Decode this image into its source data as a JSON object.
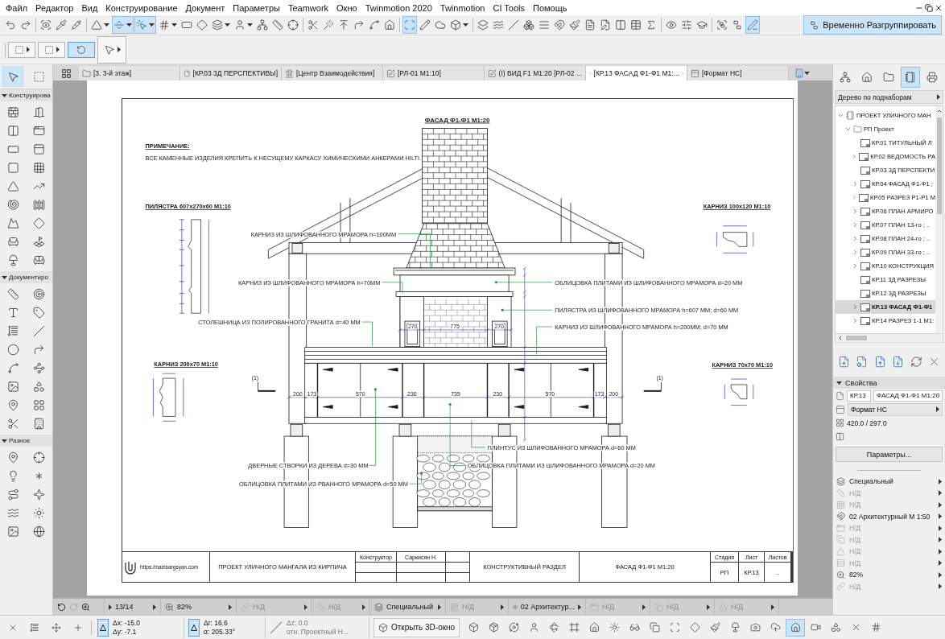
{
  "menu": [
    "Файл",
    "Редактор",
    "Вид",
    "Конструирование",
    "Документ",
    "Параметры",
    "Teamwork",
    "Окно",
    "Twinmotion 2020",
    "Twinmotion",
    "CI Tools",
    "Помощь"
  ],
  "toolbar_1": [
    {
      "kind": "undo",
      "selected": false,
      "dropdown": false
    },
    {
      "kind": "redo",
      "selected": false,
      "dropdown": false
    },
    {
      "kind": "scan-eye",
      "selected": false,
      "dropdown": false
    },
    {
      "kind": "pipette",
      "selected": false,
      "dropdown": false
    },
    {
      "kind": "syringe",
      "selected": false,
      "dropdown": false
    },
    {
      "kind": "triangle",
      "selected": false,
      "dropdown": true
    },
    {
      "kind": "guide-line",
      "selected": true,
      "dropdown": true
    },
    {
      "kind": "pointer-click",
      "selected": true,
      "dropdown": true
    },
    {
      "kind": "grid",
      "selected": false,
      "dropdown": true
    },
    {
      "kind": "plane",
      "selected": false,
      "dropdown": false
    },
    {
      "kind": "diamond",
      "selected": false,
      "dropdown": false
    },
    {
      "kind": "layers",
      "selected": false,
      "dropdown": true
    },
    {
      "kind": "person",
      "selected": false,
      "dropdown": true
    },
    {
      "kind": "network",
      "selected": false,
      "dropdown": false
    },
    {
      "kind": "ruler",
      "selected": false,
      "dropdown": false
    },
    {
      "kind": "crosshair",
      "selected": false,
      "dropdown": false
    },
    {
      "kind": "scissors",
      "selected": false,
      "dropdown": false
    },
    {
      "kind": "wand",
      "selected": false,
      "dropdown": false
    },
    {
      "kind": "arrow-up-line",
      "selected": false,
      "dropdown": false
    },
    {
      "kind": "corner-arrow",
      "selected": false,
      "dropdown": false
    },
    {
      "kind": "spline",
      "selected": false,
      "dropdown": false
    },
    {
      "kind": "house",
      "selected": false,
      "dropdown": false
    },
    {
      "kind": "select-frame",
      "selected": true,
      "dropdown": false
    },
    {
      "kind": "pencil",
      "selected": false,
      "dropdown": false
    },
    {
      "kind": "cloud",
      "selected": false,
      "dropdown": false
    },
    {
      "kind": "cube",
      "selected": false,
      "dropdown": true
    },
    {
      "kind": "stack",
      "selected": false,
      "dropdown": false
    },
    {
      "kind": "waves",
      "selected": false,
      "dropdown": false
    },
    {
      "kind": "slash",
      "selected": false,
      "dropdown": false
    },
    {
      "kind": "boxes",
      "selected": false,
      "dropdown": false
    },
    {
      "kind": "stripes",
      "selected": false,
      "dropdown": false
    },
    {
      "kind": "magnet",
      "selected": false,
      "dropdown": false
    },
    {
      "kind": "paintbrush",
      "selected": false,
      "dropdown": false
    },
    {
      "kind": "document",
      "selected": false,
      "dropdown": false
    },
    {
      "kind": "document-pen",
      "selected": false,
      "dropdown": false
    },
    {
      "kind": "columns",
      "selected": false,
      "dropdown": false
    },
    {
      "kind": "table",
      "selected": false,
      "dropdown": false
    },
    {
      "kind": "sigma",
      "selected": false,
      "dropdown": false
    },
    {
      "kind": "eye",
      "selected": false,
      "dropdown": false
    },
    {
      "kind": "sliders",
      "selected": false,
      "dropdown": false
    },
    {
      "kind": "graduation-cap",
      "selected": false,
      "dropdown": false
    },
    {
      "kind": "group",
      "selected": false,
      "dropdown": false
    },
    {
      "kind": "ungroup",
      "selected": false,
      "dropdown": false
    },
    {
      "kind": "pen-line",
      "selected": true,
      "dropdown": false
    }
  ],
  "ungroup_button": {
    "label": "Временно Разгруппировать",
    "selected": true
  },
  "toolbar_2": [
    {
      "kind": "element-set",
      "selected": false
    },
    {
      "kind": "marquee-set",
      "selected": false
    },
    {
      "kind": "rotate",
      "selected": true
    },
    {
      "kind": "pointer",
      "selected": false
    }
  ],
  "tabs": [
    {
      "kind": "floor",
      "label": "[3. 3-й этаж]",
      "selected": false
    },
    {
      "kind": "sheet",
      "label": "[КР.03 3Д ПЕРСПЕКТИВЫ]",
      "selected": false
    },
    {
      "kind": "tower",
      "label": "[Центр Взаимодействия]",
      "selected": false
    },
    {
      "kind": "detail",
      "label": "[РЛ-01 М1:10]",
      "selected": false
    },
    {
      "kind": "detail",
      "label": "(I) ВИД F1 М1:20 [РЛ-02 ...",
      "selected": false
    },
    {
      "kind": "sheet",
      "label": "[КР.13 ФАСАД Ф1-Ф1 М1:...",
      "selected": true
    },
    {
      "kind": "master",
      "label": "[Формат НС]",
      "selected": false
    }
  ],
  "toolbox": {
    "top": [
      {
        "kind": "arrow",
        "selected": true
      },
      {
        "kind": "marquee",
        "selected": false
      }
    ],
    "sections": [
      {
        "title": "Конструирова",
        "expanded": true,
        "tools": [
          {
            "kind": "wall"
          },
          {
            "kind": "door"
          },
          {
            "kind": "column"
          },
          {
            "kind": "window"
          },
          {
            "kind": "beam"
          },
          {
            "kind": "skylight"
          },
          {
            "kind": "slab"
          },
          {
            "kind": "curtain-wall"
          },
          {
            "kind": "roof"
          },
          {
            "kind": "stair"
          },
          {
            "kind": "shell"
          },
          {
            "kind": "railing"
          },
          {
            "kind": "mesh"
          },
          {
            "kind": "morph"
          },
          {
            "kind": "object"
          },
          {
            "kind": "zone"
          },
          {
            "kind": "lamp"
          },
          {
            "kind": "chair"
          }
        ]
      },
      {
        "title": "Документиро",
        "expanded": true,
        "tools": [
          {
            "kind": "ruler"
          },
          {
            "kind": "target"
          },
          {
            "kind": "type"
          },
          {
            "kind": "tag"
          },
          {
            "kind": "hatch"
          },
          {
            "kind": "slash"
          },
          {
            "kind": "circle"
          },
          {
            "kind": "arc"
          },
          {
            "kind": "spline"
          },
          {
            "kind": "polyline"
          },
          {
            "kind": "image"
          },
          {
            "kind": "shapes"
          },
          {
            "kind": "marker"
          },
          {
            "kind": "grid-dots"
          },
          {
            "kind": "section"
          },
          {
            "kind": "elevation"
          }
        ]
      },
      {
        "title": "Разное",
        "expanded": true,
        "tools": [
          {
            "kind": "map-pin"
          },
          {
            "kind": "crosshair"
          },
          {
            "kind": "lightbulb"
          },
          {
            "kind": "asterisk"
          },
          {
            "kind": "route"
          },
          {
            "kind": "sparkle"
          },
          {
            "kind": "waves"
          },
          {
            "kind": "sun"
          },
          {
            "kind": "image"
          },
          {
            "kind": "globe"
          }
        ]
      }
    ]
  },
  "sheet": {
    "title": "ФАСАД Ф1-Ф1 М1:20",
    "note_heading": "ПРИМЕЧАНИЕ:",
    "note": "ВСЕ КАМЕННЫЕ ИЗДЕЛИЯ КРЕПИТЬ К НЕСУЩЕМУ КАРКАСУ ХИМИЧЕСКИМИ АНКЕРАМИ HILTI.",
    "details": [
      "ПИЛЯСТРА 607х270х60 М1:10",
      "КАРНИЗ 200х70 М1:10",
      "КАРНИЗ 100х120 М1:10",
      "КАРНИЗ 70х70 М1:10"
    ],
    "callouts": [
      "КАРНИЗ ИЗ ШЛИФОВАННОГО МРАМОРА h=100ММ",
      "КАРНИЗ ИЗ ШЛИФОВАННОГО МРАМОРА h=70ММ",
      "ОБЛИЦОВКА ПЛИТАМИ ИЗ ШЛИФОВАННОГО МРАМОРА d=20 ММ",
      "ПИЛЯСТРА ИЗ ШЛИФОВАННОГО МРАМОРА h=607 ММ; d=60 ММ",
      "СТОЛЕШНИЦА ИЗ ПОЛИРОВАННОГО ГРАНИТА d=40 ММ",
      "КАРНИЗ ИЗ ШЛИФОВАННОГО МРАМОРА h=200ММ; d=70 ММ",
      "ПЛИНТУС ИЗ ШЛИФОВАННОГО МРАМОРА d=60 ММ",
      "ДВЕРНЫЕ СТВОРКИ ИЗ ДЕРЕВА d=30 ММ",
      "ОБЛИЦОВКА ПЛИТАМИ ИЗ ШЛИФОВАННОГО МРАМОРА d=20 ММ",
      "ОБЛИЦОВКА ПЛИТАМИ ИЗ РВАННОГО МРАМОРА d=50 ММ"
    ],
    "section_marks": [
      "(1)",
      "(1)"
    ],
    "upper_dimensions": [
      "270",
      "775",
      "270"
    ],
    "lower_dimensions": [
      "200",
      "173",
      "570",
      "230",
      "735",
      "230",
      "570",
      "173",
      "200"
    ],
    "title_block": {
      "url": "https://nairisargsyan.com",
      "project": "ПРОЕКТ УЛИЧНОГО МАНГАЛА ИЗ КИРПИЧА",
      "role": "Конструктор",
      "designer": "Саркисян Н.",
      "section": "КОНСТРУКТИВНЫЙ РАЗДЕЛ",
      "sheet_title": "ФАСАД Ф1-Ф1 М1:20",
      "stage_label": "Стадия",
      "sheet_label": "Лист",
      "sheets_label": "Листов",
      "stage": "РП",
      "sheet": "КР.13",
      "sheets": ".."
    }
  },
  "navigator": {
    "modes": [
      {
        "kind": "map",
        "selected": false
      },
      {
        "kind": "house",
        "selected": false
      },
      {
        "kind": "folder",
        "selected": false
      },
      {
        "kind": "book",
        "selected": true
      },
      {
        "kind": "printer",
        "selected": false
      }
    ],
    "view": "Дерево по поднаборам",
    "tree": {
      "kind": "book",
      "label": "ПРОЕКТ УЛИЧНОГО МАН",
      "expanded": true,
      "selected": false,
      "children": [
        {
          "kind": "folder",
          "label": "РП Проект",
          "expanded": true,
          "selected": false,
          "children": [
            {
              "kind": "sheet",
              "label": "КР.01 ТИТУЛЬНЫЙ Л",
              "expandable": false,
              "selected": false
            },
            {
              "kind": "sheet",
              "label": "КР.02 ВЕДОМОСТЬ РА",
              "expandable": true,
              "selected": false
            },
            {
              "kind": "sheet",
              "label": "КР.03 3Д ПЕРСПЕКТИ",
              "expandable": false,
              "selected": false
            },
            {
              "kind": "sheet",
              "label": "КР.04 ФАСАД Ф1-Ф1 ;",
              "expandable": true,
              "selected": false
            },
            {
              "kind": "sheet",
              "label": "КР.05 РАЗРЕЗ Р1-Р1 М",
              "expandable": true,
              "selected": false
            },
            {
              "kind": "sheet",
              "label": "КР.06 ПЛАН АРМИРО",
              "expandable": true,
              "selected": false
            },
            {
              "kind": "sheet",
              "label": "КР.07  ПЛАН 13-го ; ..",
              "expandable": true,
              "selected": false
            },
            {
              "kind": "sheet",
              "label": "КР.08  ПЛАН 24-го ; ..",
              "expandable": true,
              "selected": false
            },
            {
              "kind": "sheet",
              "label": "КР.09  ПЛАН 33-го ; ..",
              "expandable": true,
              "selected": false
            },
            {
              "kind": "sheet",
              "label": "КР.10 КОНСТРУКЦИЯ",
              "expandable": true,
              "selected": false
            },
            {
              "kind": "sheet",
              "label": "КР.11 3Д РАЗРЕЗЫ",
              "expandable": false,
              "selected": false
            },
            {
              "kind": "sheet",
              "label": "КР.12 3Д РАЗРЕЗЫ",
              "expandable": false,
              "selected": false
            },
            {
              "kind": "sheet",
              "label": "КР.13 ФАСАД Ф1-Ф1",
              "expandable": true,
              "selected": true
            },
            {
              "kind": "sheet",
              "label": "КР.14 РАЗРЕЗ 1-1 М1:",
              "expandable": true,
              "selected": false
            }
          ]
        }
      ]
    },
    "actions": [
      {
        "kind": "new-sheet"
      },
      {
        "kind": "sheet-settings"
      },
      {
        "kind": "sheet-upload"
      },
      {
        "kind": "sheet-download"
      },
      {
        "kind": "refresh"
      },
      {
        "kind": "delete"
      }
    ]
  },
  "properties": {
    "title": "Свойства",
    "expanded": true,
    "id": "КР.13",
    "name": "ФАСАД Ф1-Ф1 М1:20",
    "format": "Формат НС",
    "size": "420.0 / 297.0",
    "settings_button": "Параметры...",
    "attributes": [
      {
        "kind": "layers",
        "label": "Специальный",
        "disabled": false
      },
      {
        "kind": "dimension",
        "label": "Н/Д",
        "disabled": true
      },
      {
        "kind": "pen-set",
        "label": "Н/Д",
        "disabled": true
      },
      {
        "kind": "model-view",
        "label": "02 Архитектурный М 1:50",
        "disabled": false
      },
      {
        "kind": "override",
        "label": "Н/Д",
        "disabled": true
      },
      {
        "kind": "renovation",
        "label": "Н/Д",
        "disabled": true
      },
      {
        "kind": "structure",
        "label": "Н/Д",
        "disabled": true
      },
      {
        "kind": "partial",
        "label": "Н/Д",
        "disabled": true
      },
      {
        "kind": "zoom",
        "label": "82%",
        "disabled": false
      },
      {
        "kind": "link",
        "label": "Н/Д",
        "disabled": true
      }
    ]
  },
  "nav_bar": {
    "page": "13/14",
    "zoom": "82%",
    "segments": [
      {
        "kind": "link",
        "label": "Н/Д",
        "disabled": true
      },
      {
        "kind": "dimension",
        "label": "Н/Д",
        "disabled": true
      },
      {
        "kind": "layers",
        "label": "Специальный",
        "disabled": false
      },
      {
        "kind": "pen-set",
        "label": "Н/Д",
        "disabled": true
      },
      {
        "kind": "model-view",
        "label": "02 Архитектур...",
        "disabled": false
      },
      {
        "kind": "override",
        "label": "Н/Д",
        "disabled": true
      },
      {
        "kind": "renovation",
        "label": "Н/Д",
        "disabled": true
      },
      {
        "kind": "structure",
        "label": "Н/Д",
        "disabled": true
      }
    ]
  },
  "info_box": {
    "dx": "Δx: -15.0",
    "dy": "Δy: -7.1",
    "dr": "Δr: 16.6",
    "angle": "α: 205.33°",
    "dz": "Δz: 0.0",
    "reference": "отн. Проектный Н...",
    "open_3d": "Открыть 3D-окно",
    "left_tools": [
      {
        "kind": "close-x",
        "selected": false
      },
      {
        "kind": "hatch",
        "selected": false
      },
      {
        "kind": "move",
        "selected": false
      },
      {
        "kind": "plus",
        "selected": false
      }
    ],
    "tools": [
      {
        "kind": "cube",
        "selected": false
      },
      {
        "kind": "box",
        "selected": false
      },
      {
        "kind": "orbit",
        "selected": false
      },
      {
        "kind": "person",
        "selected": false
      },
      {
        "kind": "rotate-3d",
        "selected": false
      },
      {
        "kind": "frame",
        "selected": false
      },
      {
        "kind": "house",
        "selected": false
      },
      {
        "kind": "sun",
        "selected": false
      },
      {
        "kind": "glasses",
        "selected": false
      },
      {
        "kind": "layers-copy",
        "selected": false
      },
      {
        "kind": "select-frame",
        "selected": false
      },
      {
        "kind": "diamond",
        "selected": false
      },
      {
        "kind": "paintbrush",
        "selected": false
      },
      {
        "kind": "lamp",
        "selected": false
      },
      {
        "kind": "camera",
        "selected": false
      },
      {
        "kind": "camera-cloud",
        "selected": false
      },
      {
        "kind": "home-up",
        "selected": true
      },
      {
        "kind": "video",
        "selected": false
      },
      {
        "kind": "shapes",
        "selected": false
      },
      {
        "kind": "close-x",
        "selected": false
      },
      {
        "kind": "grid",
        "selected": false
      }
    ]
  }
}
